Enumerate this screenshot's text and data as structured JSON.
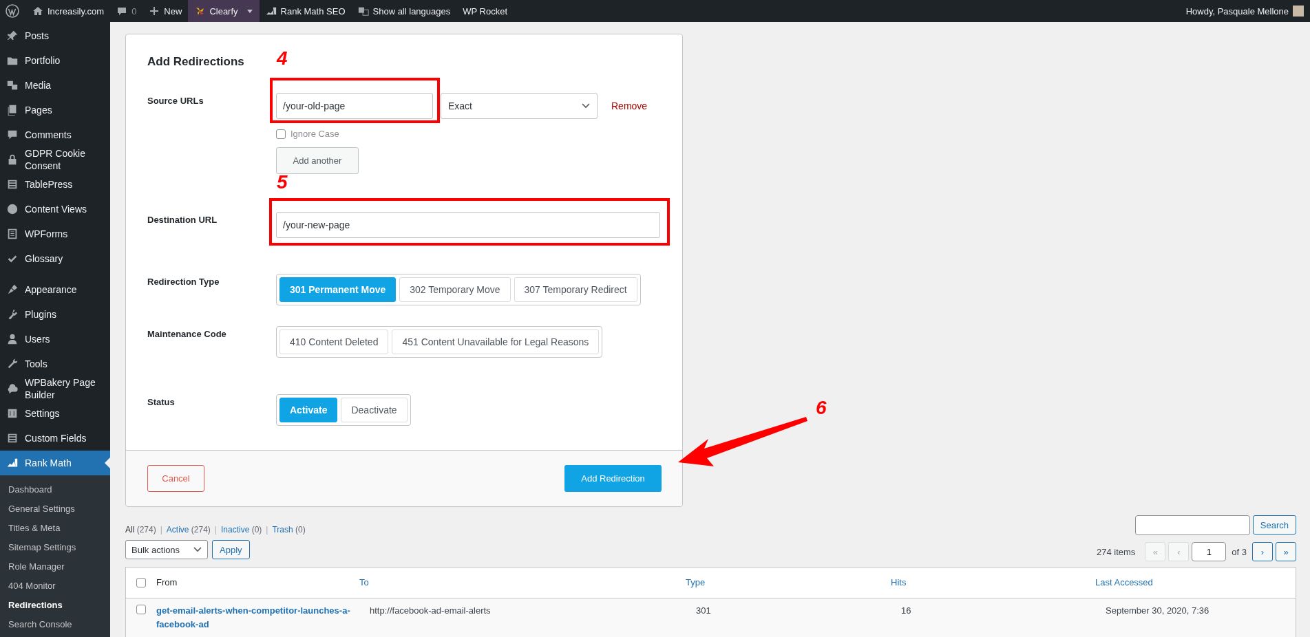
{
  "admin_bar": {
    "site_name": "Increasily.com",
    "comments_count": "0",
    "new_label": "New",
    "plugin_menu": {
      "label": "Clearfy",
      "highlighted": true
    },
    "links": [
      "Rank Math SEO",
      "Show all languages",
      "WP Rocket"
    ],
    "greeting": "Howdy, Pasquale Mellone"
  },
  "sidebar": {
    "items": [
      {
        "label": "Posts",
        "selected": false
      },
      {
        "label": "Portfolio",
        "selected": false
      },
      {
        "label": "Media",
        "selected": false
      },
      {
        "label": "Pages",
        "selected": false
      },
      {
        "label": "Comments",
        "selected": false
      },
      {
        "label": "GDPR Cookie Consent",
        "selected": false
      },
      {
        "label": "TablePress",
        "selected": false
      },
      {
        "label": "Content Views",
        "selected": false
      },
      {
        "label": "WPForms",
        "selected": false
      },
      {
        "label": "Glossary",
        "selected": false
      },
      {
        "label": "Appearance",
        "selected": false
      },
      {
        "label": "Plugins",
        "selected": false
      },
      {
        "label": "Users",
        "selected": false
      },
      {
        "label": "Tools",
        "selected": false
      },
      {
        "label": "WPBakery Page Builder",
        "selected": false
      },
      {
        "label": "Settings",
        "selected": false
      },
      {
        "label": "Custom Fields",
        "selected": false
      },
      {
        "label": "Rank Math",
        "selected": true
      }
    ],
    "submenu": [
      {
        "label": "Dashboard",
        "selected": false
      },
      {
        "label": "General Settings",
        "selected": false
      },
      {
        "label": "Titles & Meta",
        "selected": false
      },
      {
        "label": "Sitemap Settings",
        "selected": false
      },
      {
        "label": "Role Manager",
        "selected": false
      },
      {
        "label": "404 Monitor",
        "selected": false
      },
      {
        "label": "Redirections",
        "selected": true
      },
      {
        "label": "Search Console",
        "selected": false
      }
    ]
  },
  "form": {
    "title": "Add Redirections",
    "source_urls": {
      "label": "Source URLs",
      "value": "/your-old-page",
      "match": "Exact",
      "remove": "Remove",
      "ignore_case": {
        "label": "Ignore Case",
        "checked": false
      },
      "add_another": "Add another"
    },
    "destination": {
      "label": "Destination URL",
      "value": "/your-new-page"
    },
    "redirection_type": {
      "label": "Redirection Type",
      "options": [
        {
          "label": "301 Permanent Move",
          "selected": true
        },
        {
          "label": "302 Temporary Move",
          "selected": false
        },
        {
          "label": "307 Temporary Redirect",
          "selected": false
        }
      ]
    },
    "maintenance_code": {
      "label": "Maintenance Code",
      "options": [
        {
          "label": "410 Content Deleted",
          "selected": false
        },
        {
          "label": "451 Content Unavailable for Legal Reasons",
          "selected": false
        }
      ]
    },
    "status": {
      "label": "Status",
      "options": [
        {
          "label": "Activate",
          "selected": true
        },
        {
          "label": "Deactivate",
          "selected": false
        }
      ]
    },
    "cancel": "Cancel",
    "submit": "Add Redirection"
  },
  "list": {
    "filters": [
      {
        "label": "All",
        "count": "(274)",
        "selected": true
      },
      {
        "label": "Active",
        "count": "(274)",
        "selected": false
      },
      {
        "label": "Inactive",
        "count": "(0)",
        "selected": false
      },
      {
        "label": "Trash",
        "count": "(0)",
        "selected": false
      }
    ],
    "separator": "|",
    "select_all_checked": false,
    "bulk_actions": "Bulk actions",
    "apply": "Apply",
    "search_button": "Search",
    "items_count": "274 items",
    "pagination": {
      "first": "«",
      "prev": "‹",
      "page": "1",
      "of": "of 3",
      "next": "›",
      "last": "»",
      "first_disabled": true,
      "prev_disabled": true
    },
    "columns": [
      "From",
      "To",
      "Type",
      "Hits",
      "Last Accessed"
    ],
    "rows": [
      {
        "from": "get-email-alerts-when-competitor-launches-a-facebook-ad",
        "to": "http://facebook-ad-email-alerts",
        "type": "301",
        "hits": "16",
        "last_accessed": "September 30, 2020, 7:36",
        "checked": false
      }
    ]
  },
  "annotations": [
    "4",
    "5",
    "6"
  ]
}
